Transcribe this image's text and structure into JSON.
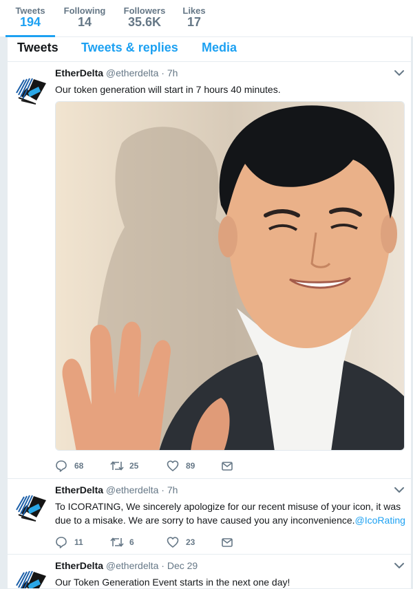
{
  "stats": [
    {
      "label": "Tweets",
      "value": "194"
    },
    {
      "label": "Following",
      "value": "14"
    },
    {
      "label": "Followers",
      "value": "35.6K"
    },
    {
      "label": "Likes",
      "value": "17"
    }
  ],
  "tabs": [
    "Tweets",
    "Tweets & replies",
    "Media"
  ],
  "tweets": [
    {
      "name": "EtherDelta",
      "handle": "@etherdelta",
      "time": "· 7h",
      "text": "Our token generation will start in 7 hours 40 minutes.",
      "replies": "68",
      "retweets": "25",
      "likes": "89"
    },
    {
      "name": "EtherDelta",
      "handle": "@etherdelta",
      "time": "· 7h",
      "text": "To ICORATING, We sincerely apologize for our recent misuse of your icon, it was due to a misake. We are sorry to have caused you any inconvenience.",
      "mention": "@IcoRating",
      "replies": "11",
      "retweets": "6",
      "likes": "23"
    },
    {
      "name": "EtherDelta",
      "handle": "@etherdelta",
      "time": "· Dec 29",
      "text": "Our Token Generation Event starts in the next one day!"
    }
  ],
  "colors": {
    "accent": "#1da1f2",
    "muted": "#657786",
    "text": "#14171a"
  },
  "icons": [
    "ethereum-logo-icon",
    "chevron-down-icon",
    "reply-icon",
    "retweet-icon",
    "heart-icon",
    "message-icon"
  ]
}
